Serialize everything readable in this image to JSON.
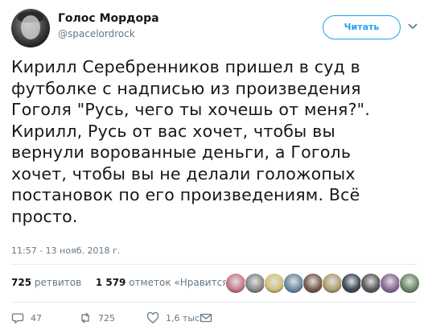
{
  "author": {
    "name": "Голос Мордора",
    "handle": "@spacelordrock",
    "avatar_icon": "user-avatar"
  },
  "follow_button": {
    "label": "Читать"
  },
  "tweet": {
    "text": "Кирилл Серебренников пришел в суд в\nфутболке с надписью из произведения\nГоголя \"Русь, чего ты хочешь от меня?\".\nКирилл, Русь от вас хочет, чтобы вы\nвернули ворованные деньги, а Гоголь\nхочет, чтобы вы не делали голожопых\nпостановок по его произведениям. Всё\nпросто.",
    "timestamp": "11:57 - 13 нояб. 2018 г."
  },
  "stats": {
    "retweets_count": "725",
    "retweets_label": "ретвитов",
    "likes_count": "1 579",
    "likes_label": "отметок «Нравится»"
  },
  "likers": [
    {
      "color": "#c97b8a"
    },
    {
      "color": "#8a8a8a"
    },
    {
      "color": "#d4c47a"
    },
    {
      "color": "#6c8aa8"
    },
    {
      "color": "#7a5a4a"
    },
    {
      "color": "#b0a070"
    },
    {
      "color": "#3a4a5a"
    },
    {
      "color": "#5a5a5a"
    },
    {
      "color": "#8a6a9a"
    },
    {
      "color": "#6a8a6a"
    }
  ],
  "actions": {
    "reply_count": "47",
    "retweet_count": "725",
    "like_count": "1,6 тыс."
  },
  "colors": {
    "accent": "#1da1f2",
    "text": "#14171a",
    "muted": "#657786"
  }
}
